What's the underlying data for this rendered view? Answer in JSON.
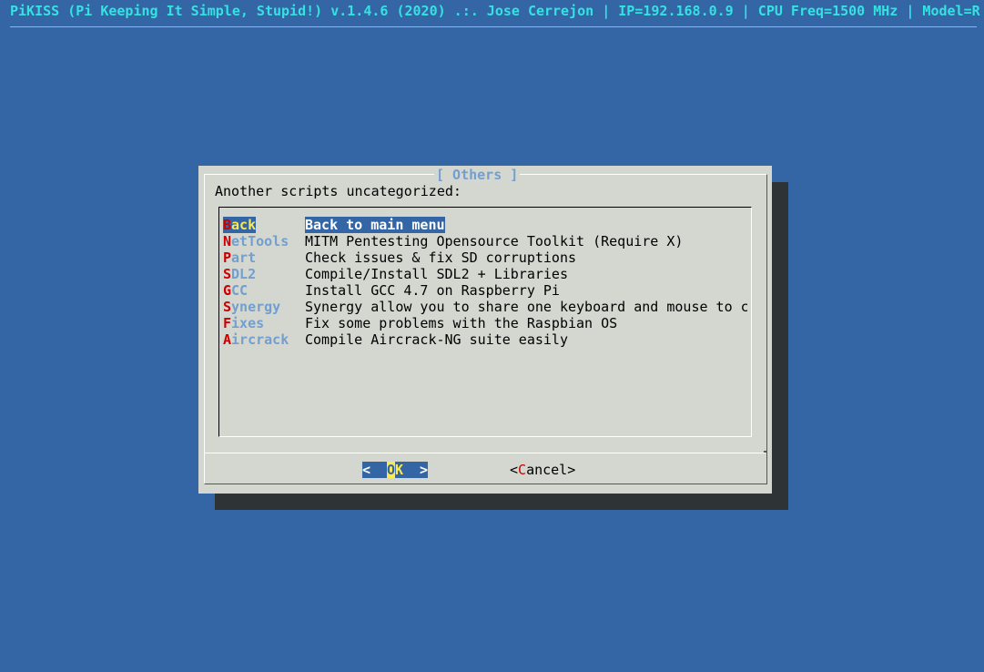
{
  "backtitle": "PiKISS (Pi Keeping It Simple, Stupid!) v.1.4.6 (2020) .:. Jose Cerrejon | IP=192.168.0.9 | CPU Freq=1500 MHz | Model=R",
  "dialog": {
    "title": "[ Others ]",
    "prompt": "Another scripts uncategorized:",
    "items": [
      {
        "hot": "B",
        "rest": "ack",
        "desc": "Back to main menu",
        "selected": true
      },
      {
        "hot": "N",
        "rest": "etTools",
        "desc": "MITM Pentesting Opensource Toolkit (Require X)",
        "selected": false
      },
      {
        "hot": "P",
        "rest": "art",
        "desc": "Check issues & fix SD corruptions",
        "selected": false
      },
      {
        "hot": "S",
        "rest": "DL2",
        "desc": "Compile/Install SDL2 + Libraries",
        "selected": false
      },
      {
        "hot": "G",
        "rest": "CC",
        "desc": "Install GCC 4.7 on Raspberry Pi",
        "selected": false
      },
      {
        "hot": "S",
        "rest": "ynergy",
        "desc": "Synergy allow you to share one keyboard and mouse to c",
        "selected": false
      },
      {
        "hot": "F",
        "rest": "ixes",
        "desc": "Fix some problems with the Raspbian OS",
        "selected": false
      },
      {
        "hot": "A",
        "rest": "ircrack",
        "desc": "Compile Aircrack-NG suite easily",
        "selected": false
      }
    ],
    "buttons": {
      "ok": {
        "left": "<",
        "hot": "O",
        "rest": "K",
        "right": ">"
      },
      "cancel": {
        "open": "<",
        "hot": "C",
        "rest": "ancel",
        "close": ">"
      }
    }
  },
  "colors": {
    "background": "#3465a4",
    "dialog": "#d3d7cf",
    "shadow": "#2e3436",
    "backtitle": "#34e2e2",
    "tag": "#729fcf",
    "hotkey": "#cc0000",
    "highlight": "#fce94f"
  }
}
